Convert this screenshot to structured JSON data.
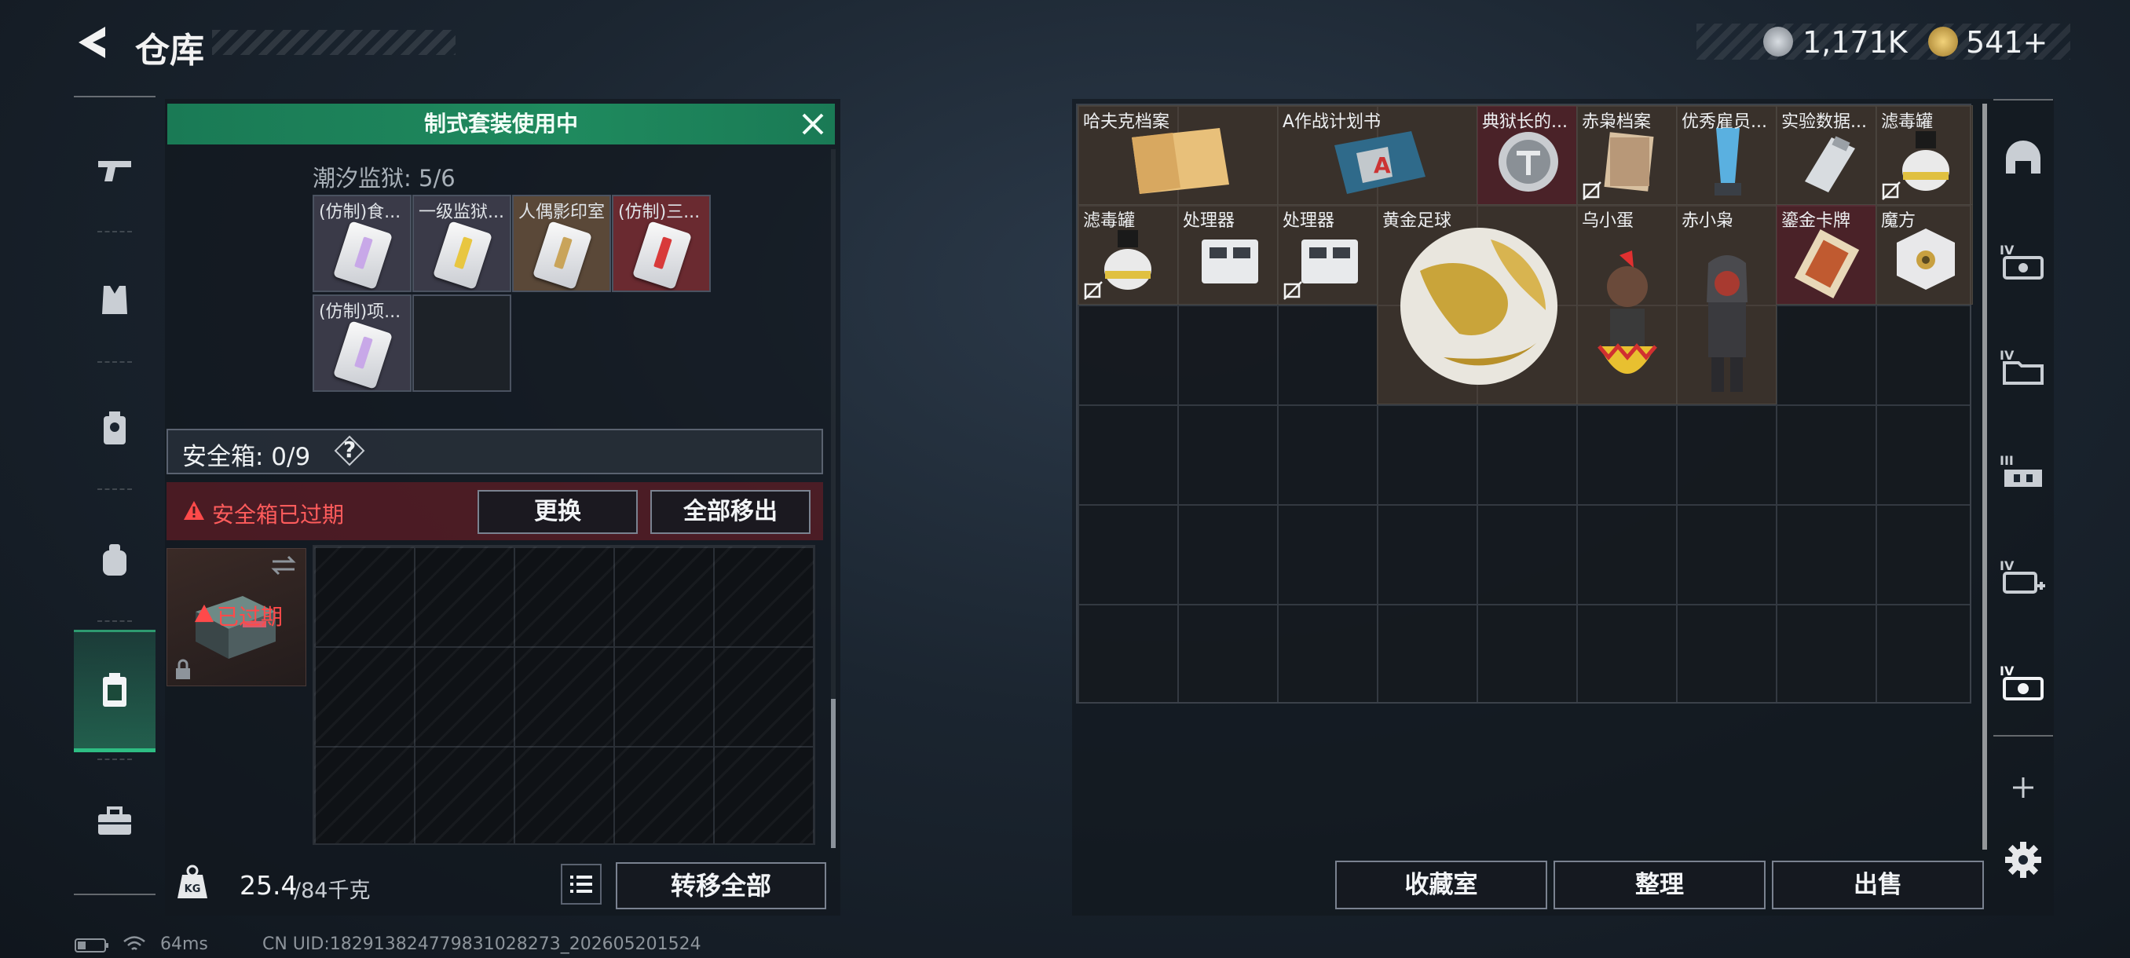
{
  "header": {
    "title": "仓库"
  },
  "currency": [
    {
      "icon": "silver-coin-icon",
      "value": "1,171K"
    },
    {
      "icon": "gold-coin-icon",
      "value": "541+"
    }
  ],
  "left_rail": [
    "pistol-icon",
    "armor-vest-icon",
    "chest-rig-icon",
    "backpack-icon",
    "safe-box-icon",
    "toolbox-icon"
  ],
  "banner": {
    "text": "制式套装使用中"
  },
  "set": {
    "label": "潮汐监狱: 5/6"
  },
  "set_items": [
    {
      "name": "(仿制)食...",
      "stripe": "#c8a8e8",
      "bg": "#3a3a48"
    },
    {
      "name": "一级监狱...",
      "stripe": "#e8c640",
      "bg": "#3a3a48"
    },
    {
      "name": "人偶影印室",
      "stripe": "#c9a45a",
      "bg": "#5a4838"
    },
    {
      "name": "(仿制)三...",
      "stripe": "#d83a3a",
      "bg": "#6a2a30"
    },
    {
      "name": "(仿制)项...",
      "stripe": "#c8a8e8",
      "bg": "#3a3a48"
    }
  ],
  "safe_box": {
    "label": "安全箱: 0/9",
    "help": "?",
    "expired_text": "安全箱已过期",
    "replace_label": "更换",
    "remove_all_label": "全部移出",
    "item_status": "已过期"
  },
  "weight": {
    "current": "25.4",
    "max": "/84千克"
  },
  "transfer_all_label": "转移全部",
  "stash_items": [
    {
      "name": "哈夫克档案",
      "style": "brown",
      "art": "file"
    },
    {
      "name": "A作战计划书",
      "style": "brown",
      "art": "book"
    },
    {
      "name": "典狱长的...",
      "style": "red",
      "art": "badge"
    },
    {
      "name": "赤枭档案",
      "style": "brown",
      "art": "papers",
      "no_trade": true
    },
    {
      "name": "优秀雇员...",
      "style": "brown",
      "art": "trophy"
    },
    {
      "name": "实验数据...",
      "style": "brown",
      "art": "drive"
    },
    {
      "name": "滤毒罐",
      "style": "brown",
      "art": "canister",
      "no_trade": true
    },
    {
      "name": "滤毒罐",
      "style": "brown",
      "art": "canister",
      "no_trade": true
    },
    {
      "name": "处理器",
      "style": "brown",
      "art": "processor"
    },
    {
      "name": "处理器",
      "style": "brown",
      "art": "processor",
      "no_trade": true
    },
    {
      "name": "黄金足球",
      "style": "brown",
      "art": "ball"
    },
    {
      "name": "乌小蛋",
      "style": "brown",
      "art": "egg"
    },
    {
      "name": "赤小枭",
      "style": "brown",
      "art": "figure"
    },
    {
      "name": "鎏金卡牌",
      "style": "red",
      "art": "card"
    },
    {
      "name": "魔方",
      "style": "brown",
      "art": "cube"
    }
  ],
  "bottom_buttons": {
    "collection": "收藏室",
    "organize": "整理",
    "sell": "出售"
  },
  "right_rail": [
    "helmet-slot-icon",
    "iv-armor-icon",
    "iv-folder-icon",
    "iii-rig-icon",
    "iv-med-icon",
    "iv-key-icon",
    "add-icon",
    "settings-icon"
  ],
  "status": {
    "ping": "64ms",
    "uid": "CN UID:182913824779831028273_202605201524"
  }
}
